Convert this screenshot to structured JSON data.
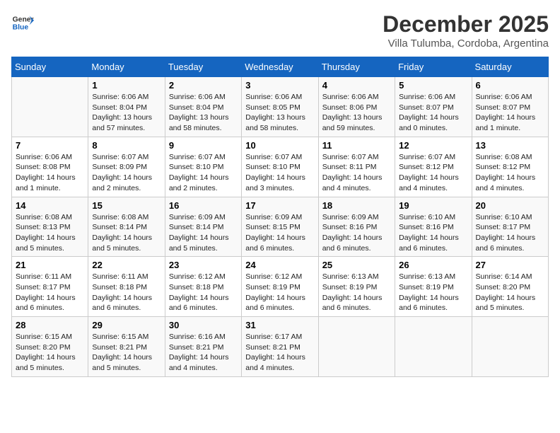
{
  "header": {
    "logo_general": "General",
    "logo_blue": "Blue",
    "month_year": "December 2025",
    "location": "Villa Tulumba, Cordoba, Argentina"
  },
  "days_of_week": [
    "Sunday",
    "Monday",
    "Tuesday",
    "Wednesday",
    "Thursday",
    "Friday",
    "Saturday"
  ],
  "weeks": [
    [
      {
        "day": "",
        "info": ""
      },
      {
        "day": "1",
        "info": "Sunrise: 6:06 AM\nSunset: 8:04 PM\nDaylight: 13 hours\nand 57 minutes."
      },
      {
        "day": "2",
        "info": "Sunrise: 6:06 AM\nSunset: 8:04 PM\nDaylight: 13 hours\nand 58 minutes."
      },
      {
        "day": "3",
        "info": "Sunrise: 6:06 AM\nSunset: 8:05 PM\nDaylight: 13 hours\nand 58 minutes."
      },
      {
        "day": "4",
        "info": "Sunrise: 6:06 AM\nSunset: 8:06 PM\nDaylight: 13 hours\nand 59 minutes."
      },
      {
        "day": "5",
        "info": "Sunrise: 6:06 AM\nSunset: 8:07 PM\nDaylight: 14 hours\nand 0 minutes."
      },
      {
        "day": "6",
        "info": "Sunrise: 6:06 AM\nSunset: 8:07 PM\nDaylight: 14 hours\nand 1 minute."
      }
    ],
    [
      {
        "day": "7",
        "info": "Sunrise: 6:06 AM\nSunset: 8:08 PM\nDaylight: 14 hours\nand 1 minute."
      },
      {
        "day": "8",
        "info": "Sunrise: 6:07 AM\nSunset: 8:09 PM\nDaylight: 14 hours\nand 2 minutes."
      },
      {
        "day": "9",
        "info": "Sunrise: 6:07 AM\nSunset: 8:10 PM\nDaylight: 14 hours\nand 2 minutes."
      },
      {
        "day": "10",
        "info": "Sunrise: 6:07 AM\nSunset: 8:10 PM\nDaylight: 14 hours\nand 3 minutes."
      },
      {
        "day": "11",
        "info": "Sunrise: 6:07 AM\nSunset: 8:11 PM\nDaylight: 14 hours\nand 4 minutes."
      },
      {
        "day": "12",
        "info": "Sunrise: 6:07 AM\nSunset: 8:12 PM\nDaylight: 14 hours\nand 4 minutes."
      },
      {
        "day": "13",
        "info": "Sunrise: 6:08 AM\nSunset: 8:12 PM\nDaylight: 14 hours\nand 4 minutes."
      }
    ],
    [
      {
        "day": "14",
        "info": "Sunrise: 6:08 AM\nSunset: 8:13 PM\nDaylight: 14 hours\nand 5 minutes."
      },
      {
        "day": "15",
        "info": "Sunrise: 6:08 AM\nSunset: 8:14 PM\nDaylight: 14 hours\nand 5 minutes."
      },
      {
        "day": "16",
        "info": "Sunrise: 6:09 AM\nSunset: 8:14 PM\nDaylight: 14 hours\nand 5 minutes."
      },
      {
        "day": "17",
        "info": "Sunrise: 6:09 AM\nSunset: 8:15 PM\nDaylight: 14 hours\nand 6 minutes."
      },
      {
        "day": "18",
        "info": "Sunrise: 6:09 AM\nSunset: 8:16 PM\nDaylight: 14 hours\nand 6 minutes."
      },
      {
        "day": "19",
        "info": "Sunrise: 6:10 AM\nSunset: 8:16 PM\nDaylight: 14 hours\nand 6 minutes."
      },
      {
        "day": "20",
        "info": "Sunrise: 6:10 AM\nSunset: 8:17 PM\nDaylight: 14 hours\nand 6 minutes."
      }
    ],
    [
      {
        "day": "21",
        "info": "Sunrise: 6:11 AM\nSunset: 8:17 PM\nDaylight: 14 hours\nand 6 minutes."
      },
      {
        "day": "22",
        "info": "Sunrise: 6:11 AM\nSunset: 8:18 PM\nDaylight: 14 hours\nand 6 minutes."
      },
      {
        "day": "23",
        "info": "Sunrise: 6:12 AM\nSunset: 8:18 PM\nDaylight: 14 hours\nand 6 minutes."
      },
      {
        "day": "24",
        "info": "Sunrise: 6:12 AM\nSunset: 8:19 PM\nDaylight: 14 hours\nand 6 minutes."
      },
      {
        "day": "25",
        "info": "Sunrise: 6:13 AM\nSunset: 8:19 PM\nDaylight: 14 hours\nand 6 minutes."
      },
      {
        "day": "26",
        "info": "Sunrise: 6:13 AM\nSunset: 8:19 PM\nDaylight: 14 hours\nand 6 minutes."
      },
      {
        "day": "27",
        "info": "Sunrise: 6:14 AM\nSunset: 8:20 PM\nDaylight: 14 hours\nand 5 minutes."
      }
    ],
    [
      {
        "day": "28",
        "info": "Sunrise: 6:15 AM\nSunset: 8:20 PM\nDaylight: 14 hours\nand 5 minutes."
      },
      {
        "day": "29",
        "info": "Sunrise: 6:15 AM\nSunset: 8:21 PM\nDaylight: 14 hours\nand 5 minutes."
      },
      {
        "day": "30",
        "info": "Sunrise: 6:16 AM\nSunset: 8:21 PM\nDaylight: 14 hours\nand 4 minutes."
      },
      {
        "day": "31",
        "info": "Sunrise: 6:17 AM\nSunset: 8:21 PM\nDaylight: 14 hours\nand 4 minutes."
      },
      {
        "day": "",
        "info": ""
      },
      {
        "day": "",
        "info": ""
      },
      {
        "day": "",
        "info": ""
      }
    ]
  ]
}
